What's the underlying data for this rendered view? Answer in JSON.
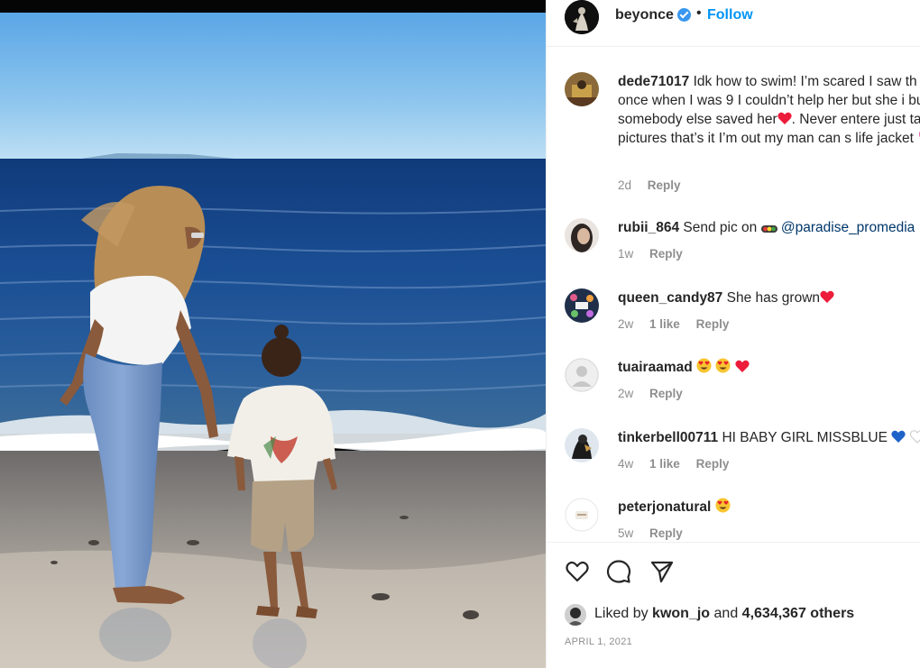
{
  "post": {
    "username": "beyonce",
    "separator": "•",
    "follow_label": "Follow",
    "photo_alt": "Woman and child standing on the beach looking at the ocean"
  },
  "comments": [
    {
      "username": "dede71017",
      "text": "Idk how to swim! I’m scared I saw th once when I was 9 I couldn’t help her but she i but somebody else saved her",
      "text_tail": ". Never entere just take pictures that’s it I’m out my man can s life jacket",
      "time": "2d",
      "likes": "",
      "reply_label": "Reply"
    },
    {
      "username": "rubii_864",
      "text": "Send pic on",
      "mention": "@paradise_promedia",
      "time": "1w",
      "likes": "",
      "reply_label": "Reply"
    },
    {
      "username": "queen_candy87",
      "text": "She has grown",
      "time": "2w",
      "likes": "1 like",
      "reply_label": "Reply"
    },
    {
      "username": "tuairaamad",
      "text": "",
      "time": "2w",
      "likes": "",
      "reply_label": "Reply"
    },
    {
      "username": "tinkerbell00711",
      "text": "HI BABY GIRL MISSBLUE",
      "time": "4w",
      "likes": "1 like",
      "reply_label": "Reply"
    },
    {
      "username": "peterjonatural",
      "text": "",
      "time": "5w",
      "likes": "",
      "reply_label": "Reply"
    }
  ],
  "footer": {
    "liked_prefix": "Liked by",
    "liked_user": "kwon_jo",
    "liked_and": "and",
    "liked_count": "4,634,367 others",
    "date": "APRIL 1, 2021"
  },
  "icons": {
    "like": "heart-outline-icon",
    "comment": "comment-bubble-icon",
    "share": "paper-plane-icon",
    "verified": "verified-badge-icon"
  },
  "colors": {
    "link": "#0095f6",
    "mention": "#00376b",
    "muted": "#8e8e8e",
    "text": "#262626",
    "verified": "#3897f0",
    "heart": "#ed1c3b"
  }
}
